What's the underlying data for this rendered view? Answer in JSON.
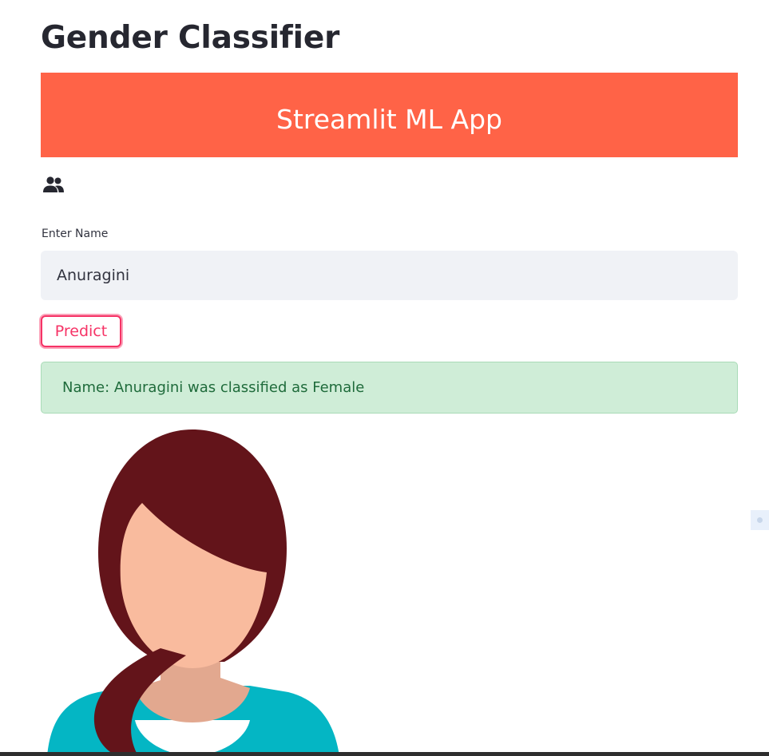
{
  "page": {
    "title": "Gender Classifier"
  },
  "banner": {
    "title": "Streamlit ML App",
    "background_color": "#ff6347"
  },
  "icons": {
    "header_icon": "people-icon"
  },
  "name_input": {
    "label": "Enter Name",
    "value": "Anuragini"
  },
  "predict_button": {
    "label": "Predict",
    "accent_color": "#f63366"
  },
  "result": {
    "message": "Name: Anuragini was classified as Female",
    "status_color": "#cfedd7"
  },
  "avatar": {
    "icon": "female-avatar-icon"
  }
}
